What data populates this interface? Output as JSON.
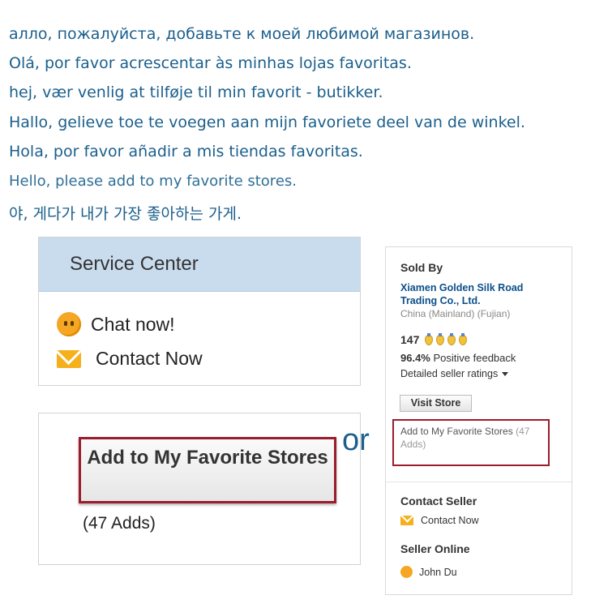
{
  "messages": [
    "алло, пожалуйста, добавьте к моей любимой магазинов.",
    "Olá, por favor acrescentar às minhas lojas favoritas.",
    "hej, vær venlig at tilføje til min favorit - butikker.",
    "Hallo, gelieve toe te voegen aan mijn favoriete deel van de winkel.",
    "Hola, por favor añadir a mis tiendas favoritas.",
    "Hello, please add to my favorite stores.",
    "야, 게다가 내가 가장 좋아하는 가게."
  ],
  "service_center": {
    "title": "Service Center",
    "chat_label": "Chat now!",
    "contact_label": "Contact Now"
  },
  "favorite_box": {
    "button_label": "Add to My Favorite Stores",
    "adds": "(47 Adds)"
  },
  "or_label": "or",
  "seller": {
    "sold_by": "Sold By",
    "store_name": "Xiamen Golden Silk Road Trading Co., Ltd.",
    "location": "China (Mainland) (Fujian)",
    "score": "147",
    "feedback_pct": "96.4%",
    "feedback_label": "Positive feedback",
    "ratings_label": "Detailed seller ratings",
    "visit_store": "Visit Store",
    "fav_link": "Add to My Favorite Stores",
    "fav_count": "(47 Adds)",
    "contact_seller": "Contact Seller",
    "contact_now": "Contact Now",
    "seller_online": "Seller Online",
    "online_name": "John Du"
  },
  "colors": {
    "text_blue": "#1b5f8c",
    "header_bg": "#c9dcee",
    "highlight_border": "#9b1c2c",
    "icon_orange": "#f5a623"
  },
  "icons": [
    "chat-face-icon",
    "envelope-icon",
    "medal-icon",
    "caret-down-icon"
  ]
}
